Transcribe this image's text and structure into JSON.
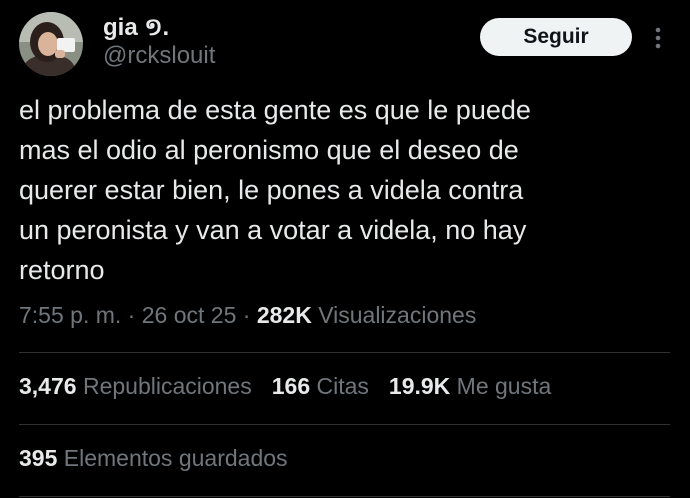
{
  "author": {
    "display_name": "gia ១.",
    "handle": "@rckslouit"
  },
  "follow_button": {
    "label": "Seguir"
  },
  "tweet": {
    "text": "el problema de esta gente es que le puede\nmas el odio al peronismo que el deseo de\nquerer estar bien, le pones a videla contra\nun peronista y van a votar a videla, no hay\nretorno",
    "time": "7:55 p. m.",
    "separator": "·",
    "date": "26 oct 25",
    "views_count": "282K",
    "views_label": "Visualizaciones"
  },
  "stats": {
    "reposts_count": "3,476",
    "reposts_label": "Republicaciones",
    "quotes_count": "166",
    "quotes_label": "Citas",
    "likes_count": "19.9K",
    "likes_label": "Me gusta"
  },
  "bookmarks": {
    "count": "395",
    "label": "Elementos guardados"
  },
  "colors": {
    "background": "#000000",
    "text_primary": "#e7e9ea",
    "text_secondary": "#71767b",
    "divider": "#2f3336",
    "button_bg": "#eff3f4"
  },
  "icons": {
    "more": "more-vertical-icon"
  }
}
